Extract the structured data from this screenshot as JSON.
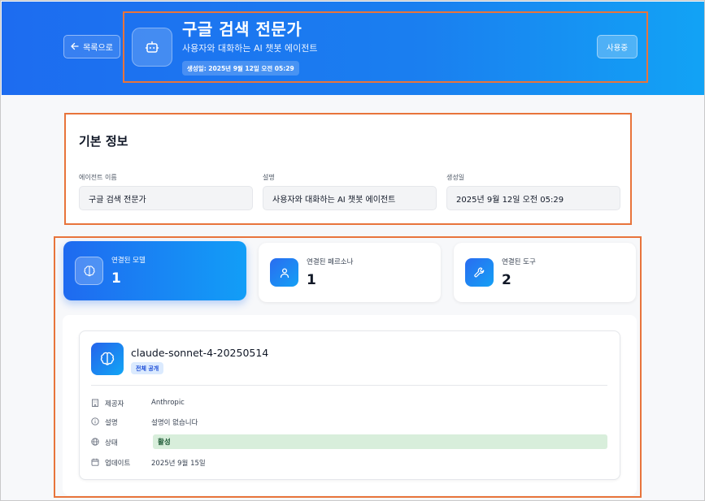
{
  "header": {
    "back_label": "목록으로",
    "title": "구글 검색 전문가",
    "subtitle": "사용자와 대화하는 AI 챗봇 에이전트",
    "created_badge": "생성일: 2025년 9월 12일 오전 05:29",
    "status_label": "사용중",
    "agent_icon": "bot-icon",
    "back_icon": "arrow-left-icon"
  },
  "basic_info": {
    "title": "기본 정보",
    "fields": [
      {
        "label": "에이전트 이름",
        "value": "구글 검색 전문가"
      },
      {
        "label": "설명",
        "value": "사용자와 대화하는 AI 챗봇 에이전트"
      },
      {
        "label": "생성일",
        "value": "2025년 9월 12일 오전 05:29"
      }
    ]
  },
  "stats": [
    {
      "label": "연결된 모델",
      "value": "1",
      "icon": "brain-icon",
      "active": true
    },
    {
      "label": "연결된 페르소나",
      "value": "1",
      "icon": "user-icon",
      "active": false
    },
    {
      "label": "연결된 도구",
      "value": "2",
      "icon": "wrench-icon",
      "active": false
    }
  ],
  "model": {
    "name": "claude-sonnet-4-20250514",
    "badge": "전체 공개",
    "icon": "brain-icon",
    "rows": [
      {
        "label": "제공자",
        "value": "Anthropic",
        "icon": "building-icon"
      },
      {
        "label": "설명",
        "value": "설명이 없습니다",
        "icon": "info-icon"
      },
      {
        "label": "상태",
        "value": "활성",
        "icon": "globe-icon"
      },
      {
        "label": "업데이트",
        "value": "2025년 9월 15일",
        "icon": "calendar-icon"
      }
    ]
  },
  "colors": {
    "header_start": "#1d6cf0",
    "header_end": "#12a3f5",
    "highlight": "#e8743b",
    "status_active_bg": "#d8eedb"
  }
}
